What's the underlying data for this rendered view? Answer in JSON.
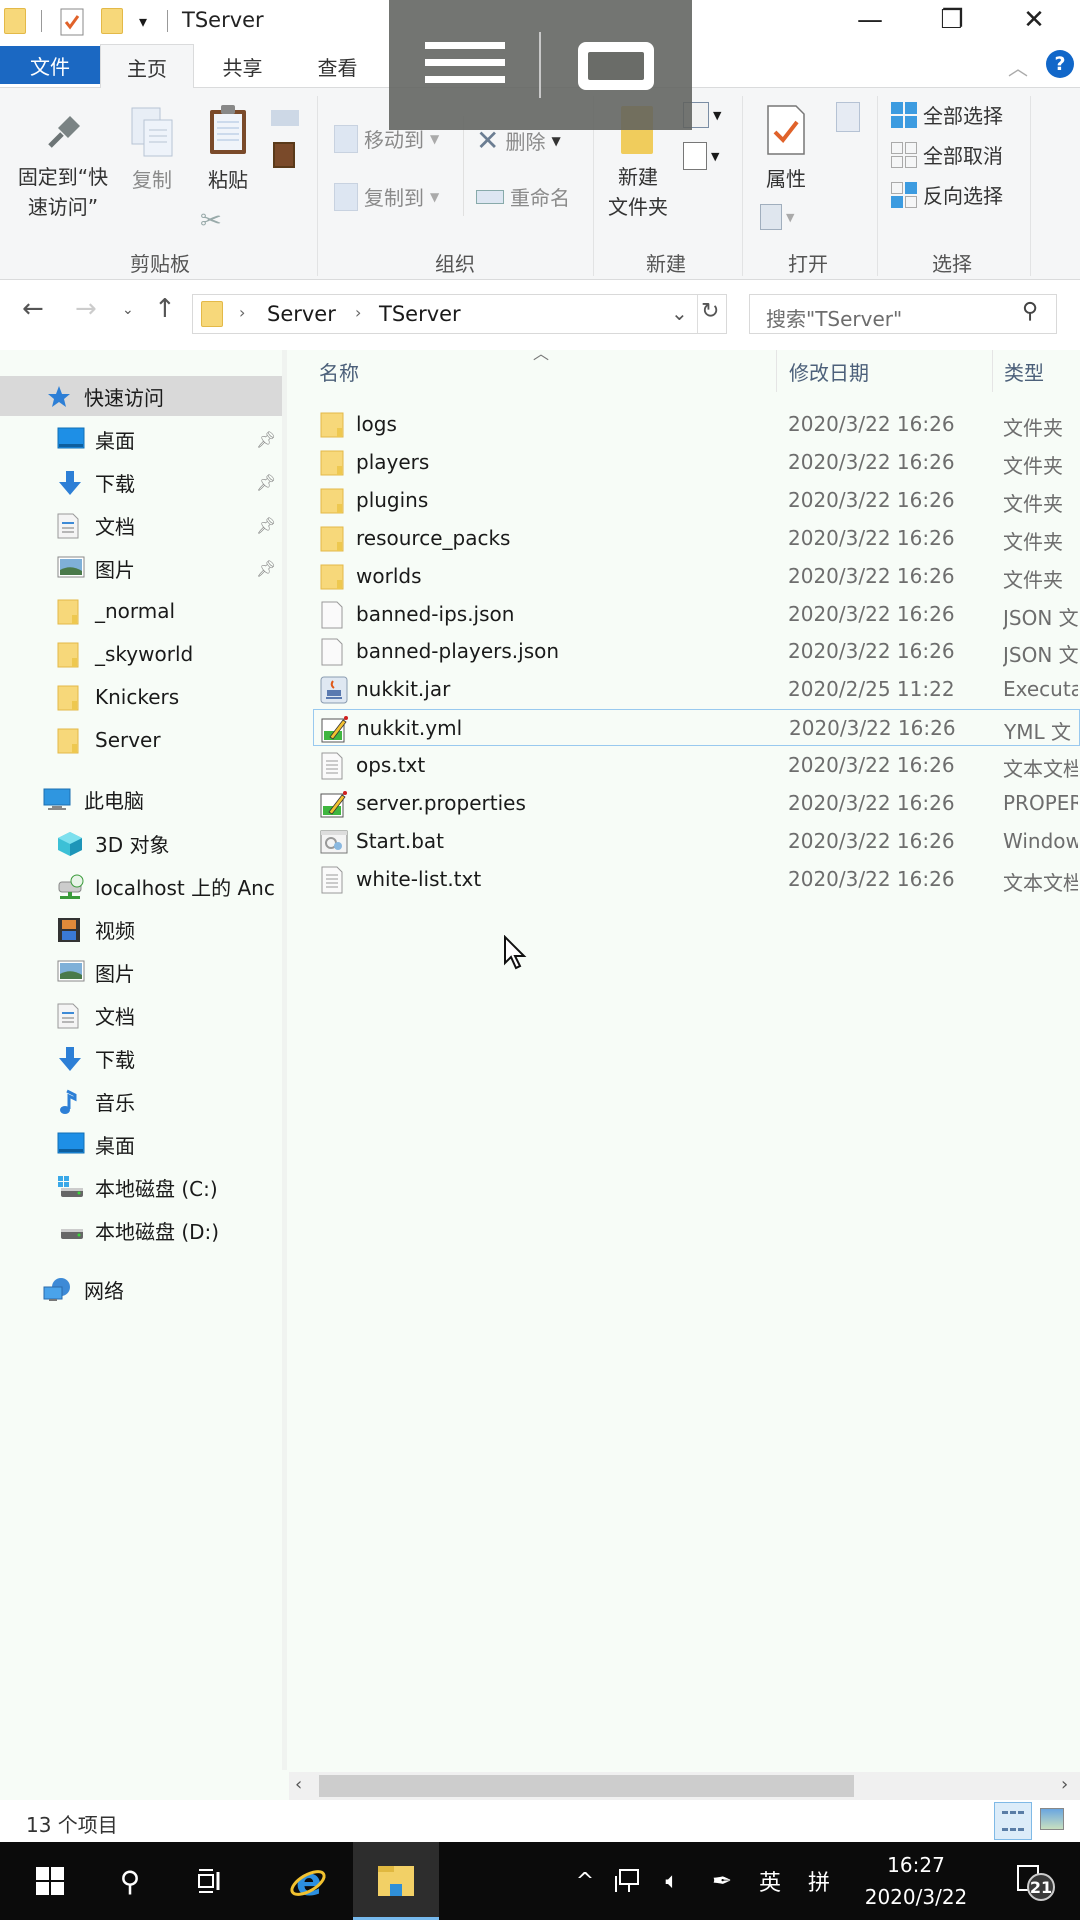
{
  "window": {
    "title": "TServer",
    "controls": {
      "minimize": "—",
      "maximize": "❐",
      "close": "✕"
    }
  },
  "ribbon": {
    "tabs": [
      {
        "label": "文件",
        "state": "file"
      },
      {
        "label": "主页",
        "state": "active"
      },
      {
        "label": "共享",
        "state": "normal"
      },
      {
        "label": "查看",
        "state": "normal"
      }
    ],
    "groups": {
      "clipboard": {
        "label": "剪贴板",
        "pin_quick_access": "固定到\"快\n速访问\"",
        "pin_line1": "固定到“快",
        "pin_line2": "速访问”",
        "copy": "复制",
        "paste": "粘贴"
      },
      "organize": {
        "label": "组织",
        "move_to": "移动到",
        "copy_to": "复制到",
        "delete": "删除",
        "rename": "重命名"
      },
      "new": {
        "label": "新建",
        "new_folder_line1": "新建",
        "new_folder_line2": "文件夹"
      },
      "open": {
        "label": "打开",
        "properties": "属性"
      },
      "select": {
        "label": "选择",
        "select_all": "全部选择",
        "select_none": "全部取消",
        "invert_selection": "反向选择"
      }
    }
  },
  "navigation": {
    "breadcrumb": [
      "Server",
      "TServer"
    ],
    "search_placeholder": "搜索\"TServer\""
  },
  "sidebar": {
    "quick_access": {
      "label": "快速访问",
      "items": [
        {
          "label": "桌面",
          "icon": "desktop-icon",
          "pinned": true
        },
        {
          "label": "下载",
          "icon": "download-icon",
          "pinned": true
        },
        {
          "label": "文档",
          "icon": "document-icon",
          "pinned": true
        },
        {
          "label": "图片",
          "icon": "picture-icon",
          "pinned": true
        },
        {
          "label": "_normal",
          "icon": "folder-icon",
          "pinned": false
        },
        {
          "label": "_skyworld",
          "icon": "folder-icon",
          "pinned": false
        },
        {
          "label": "Knickers",
          "icon": "folder-icon",
          "pinned": false
        },
        {
          "label": "Server",
          "icon": "folder-icon",
          "pinned": false
        }
      ]
    },
    "this_pc": {
      "label": "此电脑",
      "items": [
        {
          "label": "3D 对象",
          "icon": "3d-objects-icon"
        },
        {
          "label": "localhost 上的 Anc",
          "icon": "network-drive-icon"
        },
        {
          "label": "视频",
          "icon": "video-icon"
        },
        {
          "label": "图片",
          "icon": "picture-icon"
        },
        {
          "label": "文档",
          "icon": "document-icon"
        },
        {
          "label": "下载",
          "icon": "download-icon"
        },
        {
          "label": "音乐",
          "icon": "music-icon"
        },
        {
          "label": "桌面",
          "icon": "desktop-icon"
        },
        {
          "label": "本地磁盘 (C:)",
          "icon": "system-drive-icon"
        },
        {
          "label": "本地磁盘 (D:)",
          "icon": "drive-icon"
        }
      ]
    },
    "network": {
      "label": "网络"
    }
  },
  "filelist": {
    "columns": {
      "name": "名称",
      "date": "修改日期",
      "type": "类型"
    },
    "rows": [
      {
        "name": "logs",
        "date": "2020/3/22 16:26",
        "type": "文件夹",
        "icon": "folder"
      },
      {
        "name": "players",
        "date": "2020/3/22 16:26",
        "type": "文件夹",
        "icon": "folder"
      },
      {
        "name": "plugins",
        "date": "2020/3/22 16:26",
        "type": "文件夹",
        "icon": "folder"
      },
      {
        "name": "resource_packs",
        "date": "2020/3/22 16:26",
        "type": "文件夹",
        "icon": "folder"
      },
      {
        "name": "worlds",
        "date": "2020/3/22 16:26",
        "type": "文件夹",
        "icon": "folder"
      },
      {
        "name": "banned-ips.json",
        "date": "2020/3/22 16:26",
        "type": "JSON 文",
        "icon": "blank"
      },
      {
        "name": "banned-players.json",
        "date": "2020/3/22 16:26",
        "type": "JSON 文",
        "icon": "blank"
      },
      {
        "name": "nukkit.jar",
        "date": "2020/2/25 11:22",
        "type": "Executa",
        "icon": "jar"
      },
      {
        "name": "nukkit.yml",
        "date": "2020/3/22 16:26",
        "type": "YML 文",
        "icon": "edit",
        "focused": true
      },
      {
        "name": "ops.txt",
        "date": "2020/3/22 16:26",
        "type": "文本文档",
        "icon": "text"
      },
      {
        "name": "server.properties",
        "date": "2020/3/22 16:26",
        "type": "PROPER",
        "icon": "edit"
      },
      {
        "name": "Start.bat",
        "date": "2020/3/22 16:26",
        "type": "Window",
        "icon": "bat"
      },
      {
        "name": "white-list.txt",
        "date": "2020/3/22 16:26",
        "type": "文本文档",
        "icon": "text"
      }
    ]
  },
  "statusbar": {
    "item_count": "13 个项目"
  },
  "taskbar": {
    "tray": {
      "ime_lang": "英",
      "ime_mode": "拼"
    },
    "clock": {
      "time": "16:27",
      "date": "2020/3/22"
    },
    "notifications": "21"
  },
  "colors": {
    "file_tab": "#1b68c2",
    "selection_border": "#99c9ef",
    "folder": "#f7d87a",
    "taskbar": "#0b0b0b"
  }
}
